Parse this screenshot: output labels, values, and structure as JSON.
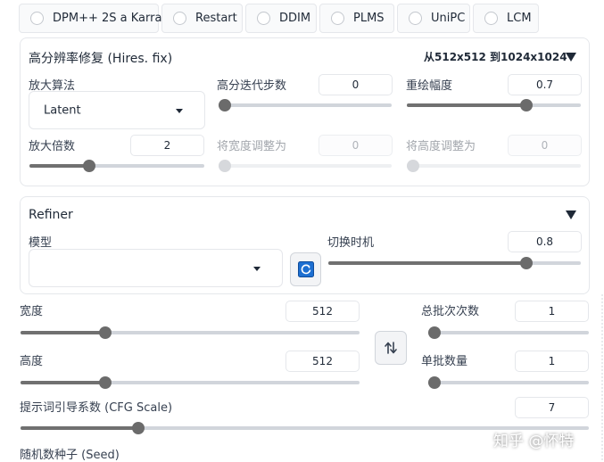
{
  "samplers": [
    {
      "label": "DPM++ 2S a Karras"
    },
    {
      "label": "Restart"
    },
    {
      "label": "DDIM"
    },
    {
      "label": "PLMS"
    },
    {
      "label": "UniPC"
    },
    {
      "label": "LCM"
    }
  ],
  "hires": {
    "title": "高分辨率修复 (Hires. fix)",
    "summary": "从512x512 到1024x1024",
    "upscaler": {
      "label": "放大算法",
      "value": "Latent"
    },
    "hires_steps": {
      "label": "高分迭代步数",
      "value": "0",
      "fraction": 0.0
    },
    "denoising": {
      "label": "重绘幅度",
      "value": "0.7",
      "fraction": 0.7
    },
    "upscale_by": {
      "label": "放大倍数",
      "value": "2",
      "fraction": 0.33
    },
    "resize_width": {
      "label": "将宽度调整为",
      "value": "0",
      "fraction": 0.0
    },
    "resize_height": {
      "label": "将高度调整为",
      "value": "0",
      "fraction": 0.0
    }
  },
  "refiner": {
    "title": "Refiner",
    "model": {
      "label": "模型",
      "value": ""
    },
    "switch_at": {
      "label": "切换时机",
      "value": "0.8",
      "fraction": 0.8
    }
  },
  "main": {
    "width": {
      "label": "宽度",
      "value": "512",
      "fraction": 0.24
    },
    "height": {
      "label": "高度",
      "value": "512",
      "fraction": 0.24
    },
    "batch_count": {
      "label": "总批次次数",
      "value": "1",
      "fraction": 0.0
    },
    "batch_size": {
      "label": "单批数量",
      "value": "1",
      "fraction": 0.0
    },
    "cfg": {
      "label": "提示词引导系数 (CFG Scale)",
      "value": "7",
      "fraction": 0.2
    },
    "seed": {
      "label": "随机数种子 (Seed)"
    }
  },
  "watermark": "知乎 @怀特",
  "colors": {
    "accent": "#6b6b6b",
    "refresh_icon": "#1d6fd1"
  }
}
